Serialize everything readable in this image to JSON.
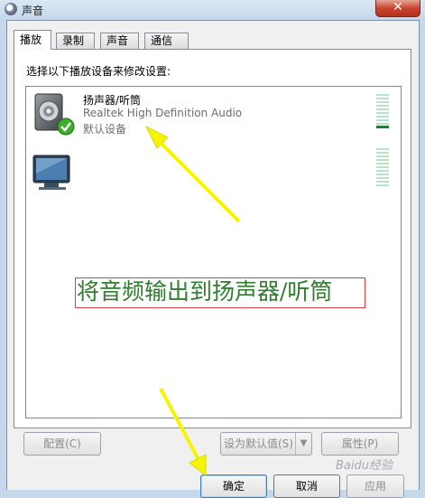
{
  "window": {
    "title": "声音",
    "close_label": "✕"
  },
  "tabs": [
    {
      "label": "播放",
      "active": true
    },
    {
      "label": "录制",
      "active": false
    },
    {
      "label": "声音",
      "active": false
    },
    {
      "label": "通信",
      "active": false
    }
  ],
  "panel": {
    "instruction": "选择以下播放设备来修改设置:"
  },
  "devices": [
    {
      "name": "扬声器/听筒",
      "driver": "Realtek High Definition Audio",
      "status": "默认设备",
      "icon": "speaker-icon",
      "default_badge": "check-icon",
      "level": 0.05
    },
    {
      "name": "",
      "driver": "",
      "status": "",
      "icon": "monitor-icon",
      "level": 0
    }
  ],
  "annotation": {
    "text": "将音频输出到扬声器/听筒",
    "text_color": "#2f7d2f",
    "box_color": "#d9434a",
    "arrow_color": "#f5f500"
  },
  "panel_buttons": {
    "configure": "配置(C)",
    "set_default": "设为默认值(S)",
    "set_default_arrow": "▼",
    "properties": "属性(P)"
  },
  "dialog_buttons": {
    "ok": "确定",
    "cancel": "取消",
    "apply": "应用"
  },
  "watermark": "Baidu经验"
}
